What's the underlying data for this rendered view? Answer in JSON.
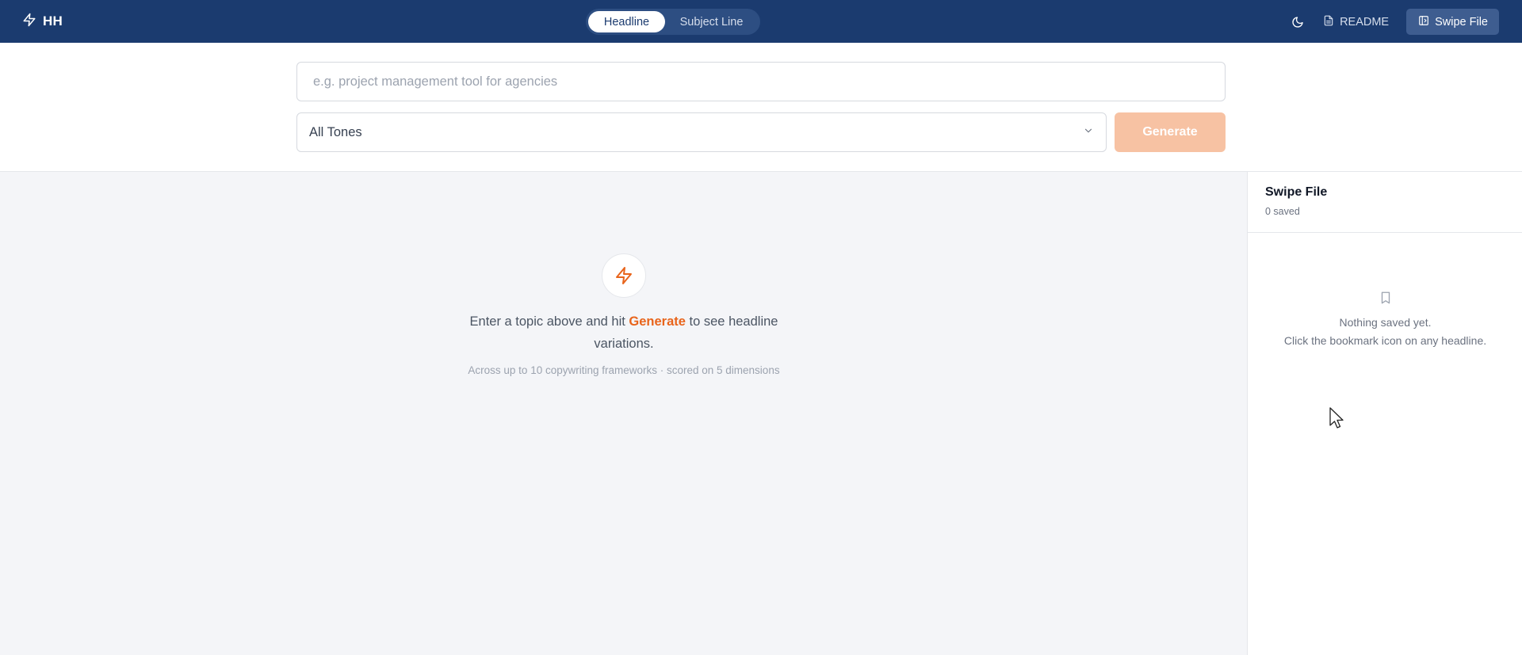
{
  "header": {
    "brand": "HH",
    "tabs": [
      {
        "label": "Headline",
        "active": true
      },
      {
        "label": "Subject Line",
        "active": false
      }
    ],
    "readme_label": "README",
    "swipe_file_label": "Swipe File",
    "icons": {
      "brand": "bolt-icon",
      "theme": "moon-icon",
      "readme": "file-text-icon",
      "swipe": "sidebar-panel-icon"
    }
  },
  "form": {
    "topic_placeholder": "e.g. project management tool for agencies",
    "topic_value": "",
    "tone_selected": "All Tones",
    "generate_label": "Generate"
  },
  "empty_state": {
    "line_before": "Enter a topic above and hit ",
    "highlight": "Generate",
    "line_after": " to see headline variations.",
    "subtext": "Across up to 10 copywriting frameworks · scored on 5 dimensions"
  },
  "sidebar": {
    "title": "Swipe File",
    "count": "0 saved",
    "empty_line1": "Nothing saved yet.",
    "empty_line2": "Click the bookmark icon on any headline."
  },
  "colors": {
    "topbar": "#1b3b6f",
    "accent": "#e8641b",
    "generate_disabled": "#f7c2a3",
    "background": "#f4f5f8"
  }
}
